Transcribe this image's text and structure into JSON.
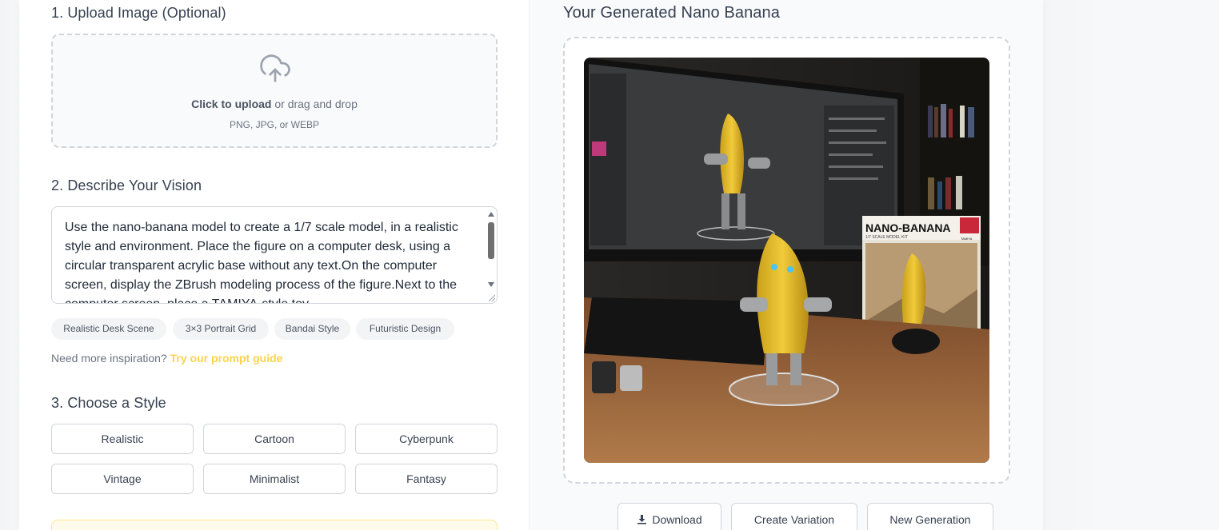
{
  "upload": {
    "section_title": "1. Upload Image (Optional)",
    "click_text": "Click to upload",
    "rest_text": " or drag and drop",
    "hint": "PNG, JPG, or WEBP"
  },
  "describe": {
    "section_title": "2. Describe Your Vision",
    "prompt_value": "Use the nano-banana model to create a 1/7 scale model, in a realistic style and environment. Place the figure on a computer desk, using a circular transparent acrylic base without any text.On the computer screen, display the ZBrush modeling process of the figure.Next to the computer screen, place a TAMIYA-style toy",
    "chips": [
      "Realistic Desk Scene",
      "3×3 Portrait Grid",
      "Bandai Style",
      "Futuristic Design"
    ],
    "inspiration_text": "Need more inspiration? ",
    "inspiration_link": "Try our prompt guide"
  },
  "style": {
    "section_title": "3. Choose a Style",
    "options": [
      "Realistic",
      "Cartoon",
      "Cyberpunk",
      "Vintage",
      "Minimalist",
      "Fantasy"
    ]
  },
  "result": {
    "title": "Your Generated Nano Banana",
    "box_title": "NANO-BANANA",
    "box_subtitle": "1/7 SCALE MODEL KIT",
    "box_brand": "TAMIYA",
    "actions": {
      "download": "Download",
      "variation": "Create Variation",
      "new": "New Generation"
    }
  },
  "colors": {
    "accent_link": "#fcd34d",
    "border": "#d1d5db",
    "text": "#374151"
  },
  "icons": {
    "upload": "cloud-upload-icon",
    "download": "download-icon"
  }
}
